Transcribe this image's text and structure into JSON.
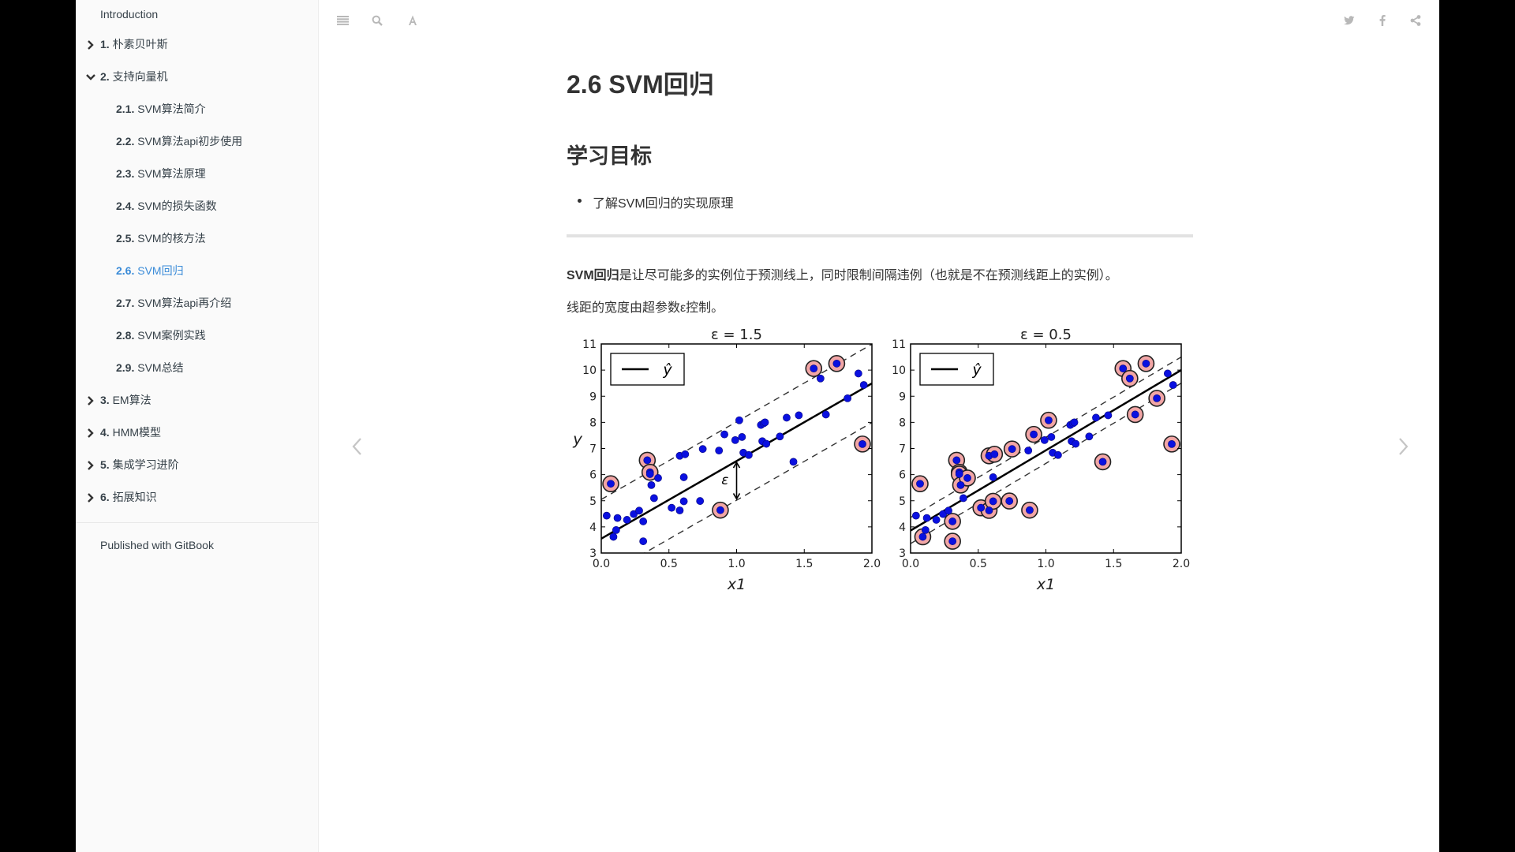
{
  "sidebar": {
    "intro": "Introduction",
    "chapters": [
      {
        "num": "1.",
        "label": "朴素贝叶斯",
        "expanded": false
      },
      {
        "num": "2.",
        "label": "支持向量机",
        "expanded": true,
        "children": [
          {
            "num": "2.1.",
            "label": "SVM算法简介"
          },
          {
            "num": "2.2.",
            "label": "SVM算法api初步使用"
          },
          {
            "num": "2.3.",
            "label": "SVM算法原理"
          },
          {
            "num": "2.4.",
            "label": "SVM的损失函数"
          },
          {
            "num": "2.5.",
            "label": "SVM的核方法"
          },
          {
            "num": "2.6.",
            "label": "SVM回归",
            "active": true
          },
          {
            "num": "2.7.",
            "label": "SVM算法api再介绍"
          },
          {
            "num": "2.8.",
            "label": "SVM案例实践"
          },
          {
            "num": "2.9.",
            "label": "SVM总结"
          }
        ]
      },
      {
        "num": "3.",
        "label": "EM算法",
        "expanded": false
      },
      {
        "num": "4.",
        "label": "HMM模型",
        "expanded": false
      },
      {
        "num": "5.",
        "label": "集成学习进阶",
        "expanded": false
      },
      {
        "num": "6.",
        "label": "拓展知识",
        "expanded": false
      }
    ],
    "footer": "Published with GitBook"
  },
  "toolbar": {
    "left_icons": [
      "menu-icon",
      "search-icon",
      "font-settings-icon"
    ],
    "right_icons": [
      "twitter-icon",
      "facebook-icon",
      "share-icon"
    ]
  },
  "page": {
    "title": "2.6 SVM回归",
    "section_title": "学习目标",
    "goals": [
      "了解SVM回归的实现原理"
    ],
    "para1_bold": "SVM回归",
    "para1_rest": "是让尽可能多的实例位于预测线上，同时限制间隔违例（也就是不在预测线距上的实例）。",
    "para2": "线距的宽度由超参数ε控制。"
  },
  "accent_color": "#3a8bd8",
  "chart_data": [
    {
      "type": "scatter",
      "title": "ε = 1.5",
      "xlabel": "x1",
      "ylabel": "y",
      "xlim": [
        0.0,
        2.0
      ],
      "ylim": [
        3,
        11
      ],
      "xticks": [
        "0.0",
        "0.5",
        "1.0",
        "1.5",
        "2.0"
      ],
      "yticks": [
        "3",
        "4",
        "5",
        "6",
        "7",
        "8",
        "9",
        "10",
        "11"
      ],
      "legend": {
        "label": "ŷ",
        "position": "top-left"
      },
      "epsilon": 1.5,
      "regression_line": {
        "intercept": 3.55,
        "slope": 2.97
      },
      "annotation": "ε",
      "points": [
        [
          0.04,
          4.43
        ],
        [
          0.07,
          5.65
        ],
        [
          0.09,
          3.62
        ],
        [
          0.11,
          3.88
        ],
        [
          0.12,
          4.34
        ],
        [
          0.19,
          4.27
        ],
        [
          0.24,
          4.49
        ],
        [
          0.28,
          4.62
        ],
        [
          0.31,
          4.21
        ],
        [
          0.31,
          3.45
        ],
        [
          0.34,
          6.55
        ],
        [
          0.36,
          6.09
        ],
        [
          0.36,
          6.02
        ],
        [
          0.37,
          5.6
        ],
        [
          0.39,
          5.1
        ],
        [
          0.42,
          5.87
        ],
        [
          0.52,
          4.73
        ],
        [
          0.58,
          6.72
        ],
        [
          0.58,
          4.63
        ],
        [
          0.61,
          5.9
        ],
        [
          0.61,
          4.98
        ],
        [
          0.62,
          6.78
        ],
        [
          0.73,
          4.99
        ],
        [
          0.75,
          6.98
        ],
        [
          0.87,
          6.92
        ],
        [
          0.88,
          4.64
        ],
        [
          0.91,
          7.54
        ],
        [
          0.99,
          7.32
        ],
        [
          1.02,
          8.08
        ],
        [
          1.04,
          7.44
        ],
        [
          1.05,
          6.84
        ],
        [
          1.09,
          6.75
        ],
        [
          1.18,
          7.9
        ],
        [
          1.19,
          7.28
        ],
        [
          1.2,
          7.96
        ],
        [
          1.21,
          8.0
        ],
        [
          1.22,
          7.18
        ],
        [
          1.32,
          7.46
        ],
        [
          1.37,
          8.18
        ],
        [
          1.42,
          6.49
        ],
        [
          1.46,
          8.27
        ],
        [
          1.57,
          10.06
        ],
        [
          1.62,
          9.68
        ],
        [
          1.66,
          8.3
        ],
        [
          1.74,
          10.25
        ],
        [
          1.82,
          8.92
        ],
        [
          1.9,
          9.87
        ],
        [
          1.93,
          7.17
        ],
        [
          1.94,
          9.43
        ]
      ],
      "support_vectors": [
        [
          0.07,
          5.65
        ],
        [
          0.34,
          6.55
        ],
        [
          0.36,
          6.09
        ],
        [
          0.88,
          4.64
        ],
        [
          1.57,
          10.06
        ],
        [
          1.74,
          10.25
        ],
        [
          1.93,
          7.17
        ]
      ]
    },
    {
      "type": "scatter",
      "title": "ε = 0.5",
      "xlabel": "x1",
      "ylabel": "",
      "xlim": [
        0.0,
        2.0
      ],
      "ylim": [
        3,
        11
      ],
      "xticks": [
        "0.0",
        "0.5",
        "1.0",
        "1.5",
        "2.0"
      ],
      "yticks": [
        "3",
        "4",
        "5",
        "6",
        "7",
        "8",
        "9",
        "10",
        "11"
      ],
      "legend": {
        "label": "ŷ",
        "position": "top-left"
      },
      "epsilon": 0.5,
      "regression_line": {
        "intercept": 3.86,
        "slope": 3.07
      },
      "points": [
        [
          0.04,
          4.43
        ],
        [
          0.07,
          5.65
        ],
        [
          0.09,
          3.62
        ],
        [
          0.11,
          3.88
        ],
        [
          0.12,
          4.34
        ],
        [
          0.19,
          4.27
        ],
        [
          0.24,
          4.49
        ],
        [
          0.28,
          4.62
        ],
        [
          0.31,
          4.21
        ],
        [
          0.31,
          3.45
        ],
        [
          0.34,
          6.55
        ],
        [
          0.36,
          6.09
        ],
        [
          0.36,
          6.02
        ],
        [
          0.37,
          5.6
        ],
        [
          0.39,
          5.1
        ],
        [
          0.42,
          5.87
        ],
        [
          0.52,
          4.73
        ],
        [
          0.58,
          6.72
        ],
        [
          0.58,
          4.63
        ],
        [
          0.61,
          5.9
        ],
        [
          0.61,
          4.98
        ],
        [
          0.62,
          6.78
        ],
        [
          0.73,
          4.99
        ],
        [
          0.75,
          6.98
        ],
        [
          0.87,
          6.92
        ],
        [
          0.88,
          4.64
        ],
        [
          0.91,
          7.54
        ],
        [
          0.99,
          7.32
        ],
        [
          1.02,
          8.08
        ],
        [
          1.04,
          7.44
        ],
        [
          1.05,
          6.84
        ],
        [
          1.09,
          6.75
        ],
        [
          1.18,
          7.9
        ],
        [
          1.19,
          7.28
        ],
        [
          1.2,
          7.96
        ],
        [
          1.21,
          8.0
        ],
        [
          1.22,
          7.18
        ],
        [
          1.32,
          7.46
        ],
        [
          1.37,
          8.18
        ],
        [
          1.42,
          6.49
        ],
        [
          1.46,
          8.27
        ],
        [
          1.57,
          10.06
        ],
        [
          1.62,
          9.68
        ],
        [
          1.66,
          8.3
        ],
        [
          1.74,
          10.25
        ],
        [
          1.82,
          8.92
        ],
        [
          1.9,
          9.87
        ],
        [
          1.93,
          7.17
        ],
        [
          1.94,
          9.43
        ]
      ],
      "support_vectors": [
        [
          0.07,
          5.65
        ],
        [
          0.09,
          3.62
        ],
        [
          0.31,
          4.21
        ],
        [
          0.31,
          3.45
        ],
        [
          0.34,
          6.55
        ],
        [
          0.36,
          6.09
        ],
        [
          0.36,
          6.02
        ],
        [
          0.37,
          5.6
        ],
        [
          0.42,
          5.87
        ],
        [
          0.52,
          4.73
        ],
        [
          0.58,
          6.72
        ],
        [
          0.58,
          4.63
        ],
        [
          0.61,
          4.98
        ],
        [
          0.62,
          6.78
        ],
        [
          0.73,
          4.99
        ],
        [
          0.75,
          6.98
        ],
        [
          0.88,
          4.64
        ],
        [
          0.91,
          7.54
        ],
        [
          1.02,
          8.08
        ],
        [
          1.42,
          6.49
        ],
        [
          1.57,
          10.06
        ],
        [
          1.62,
          9.68
        ],
        [
          1.66,
          8.3
        ],
        [
          1.74,
          10.25
        ],
        [
          1.82,
          8.92
        ],
        [
          1.93,
          7.17
        ]
      ]
    }
  ]
}
